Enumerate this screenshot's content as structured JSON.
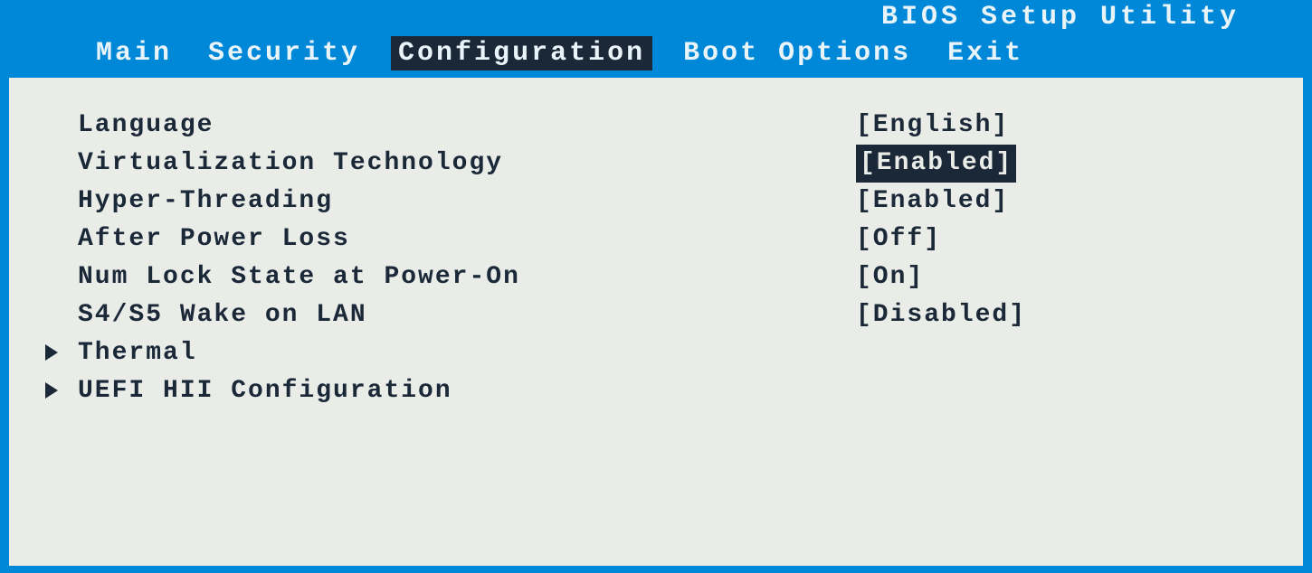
{
  "header": {
    "title": "BIOS Setup Utility",
    "tabs": [
      {
        "label": "Main",
        "active": false
      },
      {
        "label": "Security",
        "active": false
      },
      {
        "label": "Configuration",
        "active": true
      },
      {
        "label": "Boot Options",
        "active": false
      },
      {
        "label": "Exit",
        "active": false
      }
    ]
  },
  "settings": [
    {
      "label": "Language",
      "value": "[English]",
      "selected": false,
      "submenu": false
    },
    {
      "label": "Virtualization Technology",
      "value": "[Enabled]",
      "selected": true,
      "submenu": false
    },
    {
      "label": "Hyper-Threading",
      "value": "[Enabled]",
      "selected": false,
      "submenu": false
    },
    {
      "label": "After Power Loss",
      "value": "[Off]",
      "selected": false,
      "submenu": false
    },
    {
      "label": "Num Lock State at Power-On",
      "value": "[On]",
      "selected": false,
      "submenu": false
    },
    {
      "label": "S4/S5 Wake on LAN",
      "value": "[Disabled]",
      "selected": false,
      "submenu": false
    },
    {
      "label": "Thermal",
      "value": "",
      "selected": false,
      "submenu": true
    },
    {
      "label": "UEFI HII Configuration",
      "value": "",
      "selected": false,
      "submenu": true
    }
  ]
}
